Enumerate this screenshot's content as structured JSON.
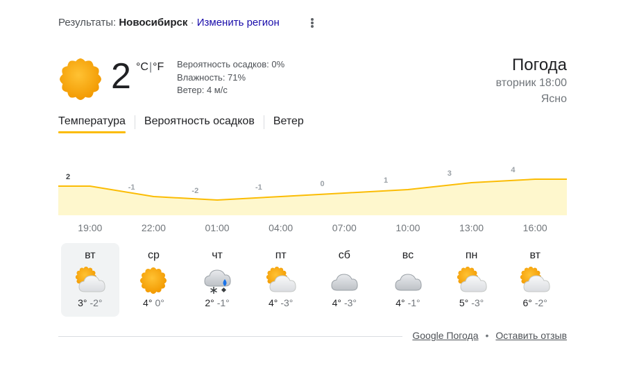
{
  "header": {
    "results_prefix": "Результаты:",
    "city": "Новосибирск",
    "dot": "·",
    "change_region": "Изменить регион"
  },
  "current": {
    "icon": "sunny-icon",
    "temp": "2",
    "unit_c": "°C",
    "unit_sep": "|",
    "unit_f": "°F",
    "precip": "Вероятность осадков: 0%",
    "humidity": "Влажность: 71%",
    "wind": "Ветер: 4 м/с"
  },
  "title_block": {
    "title": "Погода",
    "datetime": "вторник 18:00",
    "condition": "Ясно"
  },
  "tabs": [
    {
      "label": "Температура",
      "active": true
    },
    {
      "label": "Вероятность осадков",
      "active": false
    },
    {
      "label": "Ветер",
      "active": false
    }
  ],
  "chart_data": {
    "type": "area",
    "x": [
      "19:00",
      "22:00",
      "01:00",
      "04:00",
      "07:00",
      "10:00",
      "13:00",
      "16:00"
    ],
    "values": [
      2,
      -1,
      -2,
      -1,
      0,
      1,
      3,
      4
    ],
    "point_labels": [
      "2",
      "-1",
      "-2",
      "-1",
      "0",
      "1",
      "3",
      "4"
    ],
    "fill_color": "#fef7cd",
    "line_color": "#fbbc04"
  },
  "days": [
    {
      "name": "вт",
      "icon": "partly-cloudy-icon",
      "high": "3°",
      "low": "-2°",
      "selected": true
    },
    {
      "name": "ср",
      "icon": "sunny-icon",
      "high": "4°",
      "low": "0°",
      "selected": false
    },
    {
      "name": "чт",
      "icon": "cloudy-snow-rain-icon",
      "high": "2°",
      "low": "-1°",
      "selected": false
    },
    {
      "name": "пт",
      "icon": "partly-cloudy-icon",
      "high": "4°",
      "low": "-3°",
      "selected": false
    },
    {
      "name": "сб",
      "icon": "cloudy-icon",
      "high": "4°",
      "low": "-3°",
      "selected": false
    },
    {
      "name": "вс",
      "icon": "cloudy-icon",
      "high": "4°",
      "low": "-1°",
      "selected": false
    },
    {
      "name": "пн",
      "icon": "partly-cloudy-icon",
      "high": "5°",
      "low": "-3°",
      "selected": false
    },
    {
      "name": "вт",
      "icon": "partly-cloudy-icon",
      "high": "6°",
      "low": "-2°",
      "selected": false
    }
  ],
  "footer": {
    "source_link": "Google Погода",
    "bullet": "•",
    "feedback_link": "Оставить отзыв"
  }
}
